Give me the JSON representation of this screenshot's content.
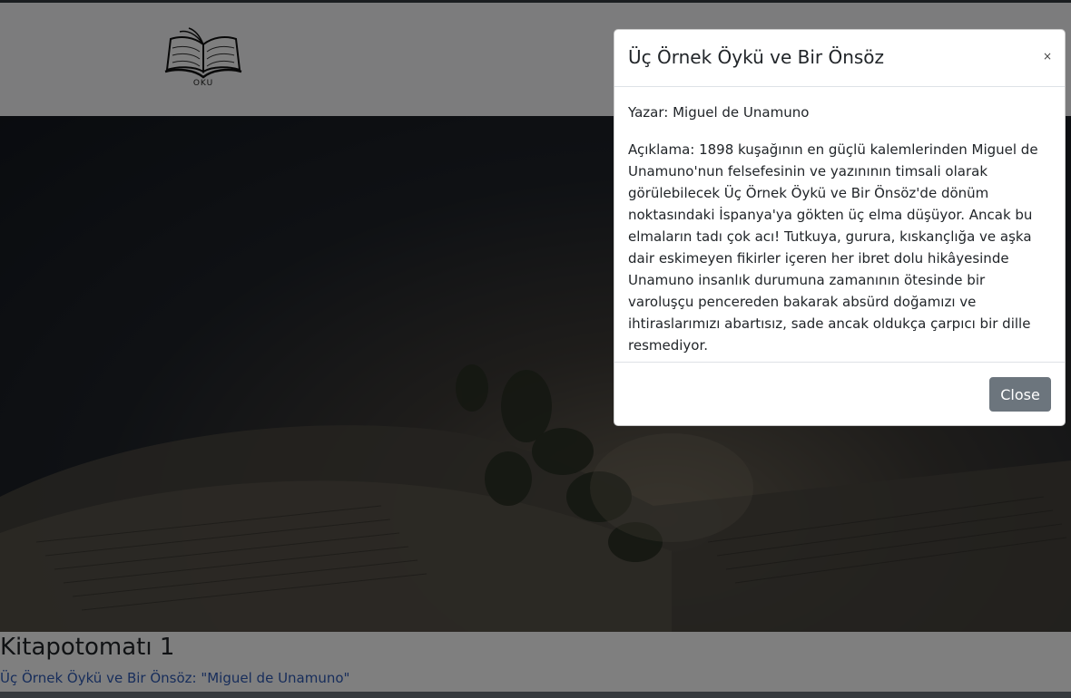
{
  "brand": {
    "text": "OKU"
  },
  "hero": {
    "image": "open-book-with-lavender-photo"
  },
  "main": {
    "title": "Kitapotomatı 1",
    "book_link": "Üç Örnek Öykü ve Bir Önsöz: \"Miguel de Unamuno\""
  },
  "modal": {
    "title": "Üç Örnek Öykü ve Bir Önsöz",
    "close_x": "×",
    "author": "Yazar: Miguel de Unamuno",
    "description": "Açıklama: 1898 kuşağının en güçlü kalemlerinden Miguel de Unamuno'nun felsefesinin ve yazınının timsali olarak görülebilecek Üç Örnek Öykü ve Bir Önsöz'de dönüm noktasındaki İspanya'ya gökten üç elma düşüyor. Ancak bu elmaların tadı çok acı! Tutkuya, gurura, kıskançlığa ve aşka dair eskimeyen fikirler içeren her ibret dolu hikâyesinde Unamuno insanlık durumuna zamanının ötesinde bir varoluşçu pencereden bakarak absürd doğamızı ve ihtiraslarımızı abartısız, sade ancak oldukça çarpıcı bir dille resmediyor.",
    "close_button": "Close"
  },
  "colors": {
    "link": "#2f5bb7",
    "button_secondary": "#6c757d",
    "backdrop": "rgba(0,0,0,0.5)"
  }
}
